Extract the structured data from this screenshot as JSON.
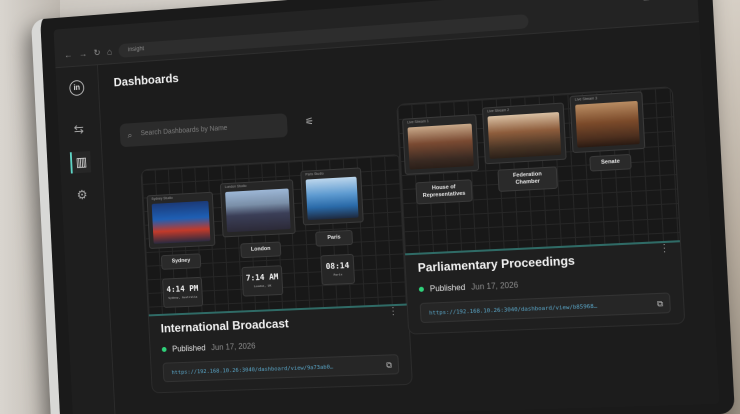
{
  "browser": {
    "address": "insight",
    "icons": [
      "back-icon",
      "forward-icon",
      "reload-icon",
      "home-icon"
    ],
    "top_icons": [
      "extensions-icon",
      "profile-icon",
      "download-icon"
    ]
  },
  "app": {
    "logo": "in",
    "nav": [
      "flows-icon",
      "dashboards-icon",
      "settings-icon"
    ],
    "active_nav": "dashboards-icon"
  },
  "page": {
    "title": "Dashboards",
    "search_placeholder": "Search Dashboards by Name"
  },
  "cards": [
    {
      "title": "International Broadcast",
      "status": "Published",
      "date": "Jun 17, 2026",
      "url": "https://192.168.10.26:3040/dashboard/view/9a73ab0…",
      "status_color": "#2fd17a",
      "tiles": [
        {
          "label": "Sydney",
          "tag": "Sydney Studio"
        },
        {
          "label": "London",
          "tag": "London Studio"
        },
        {
          "label": "Paris",
          "tag": "Paris Studio"
        }
      ],
      "clocks": [
        {
          "time": "4:14 PM",
          "caption": "Sydney, Australia"
        },
        {
          "time": "7:14 AM",
          "caption": "London, UK"
        },
        {
          "time": "08:14",
          "caption": "Paris"
        }
      ]
    },
    {
      "title": "Parliamentary Proceedings",
      "status": "Published",
      "date": "Jun 17, 2026",
      "url": "https://192.168.10.26:3040/dashboard/view/b85968…",
      "status_color": "#2fd17a",
      "tiles": [
        {
          "label": "House of Representatives",
          "tag": "Live Stream 1"
        },
        {
          "label": "Federation Chamber",
          "tag": "Live Stream 2"
        },
        {
          "label": "Senate",
          "tag": "Live Stream 3"
        }
      ]
    }
  ],
  "accent": "#5fd3c4"
}
